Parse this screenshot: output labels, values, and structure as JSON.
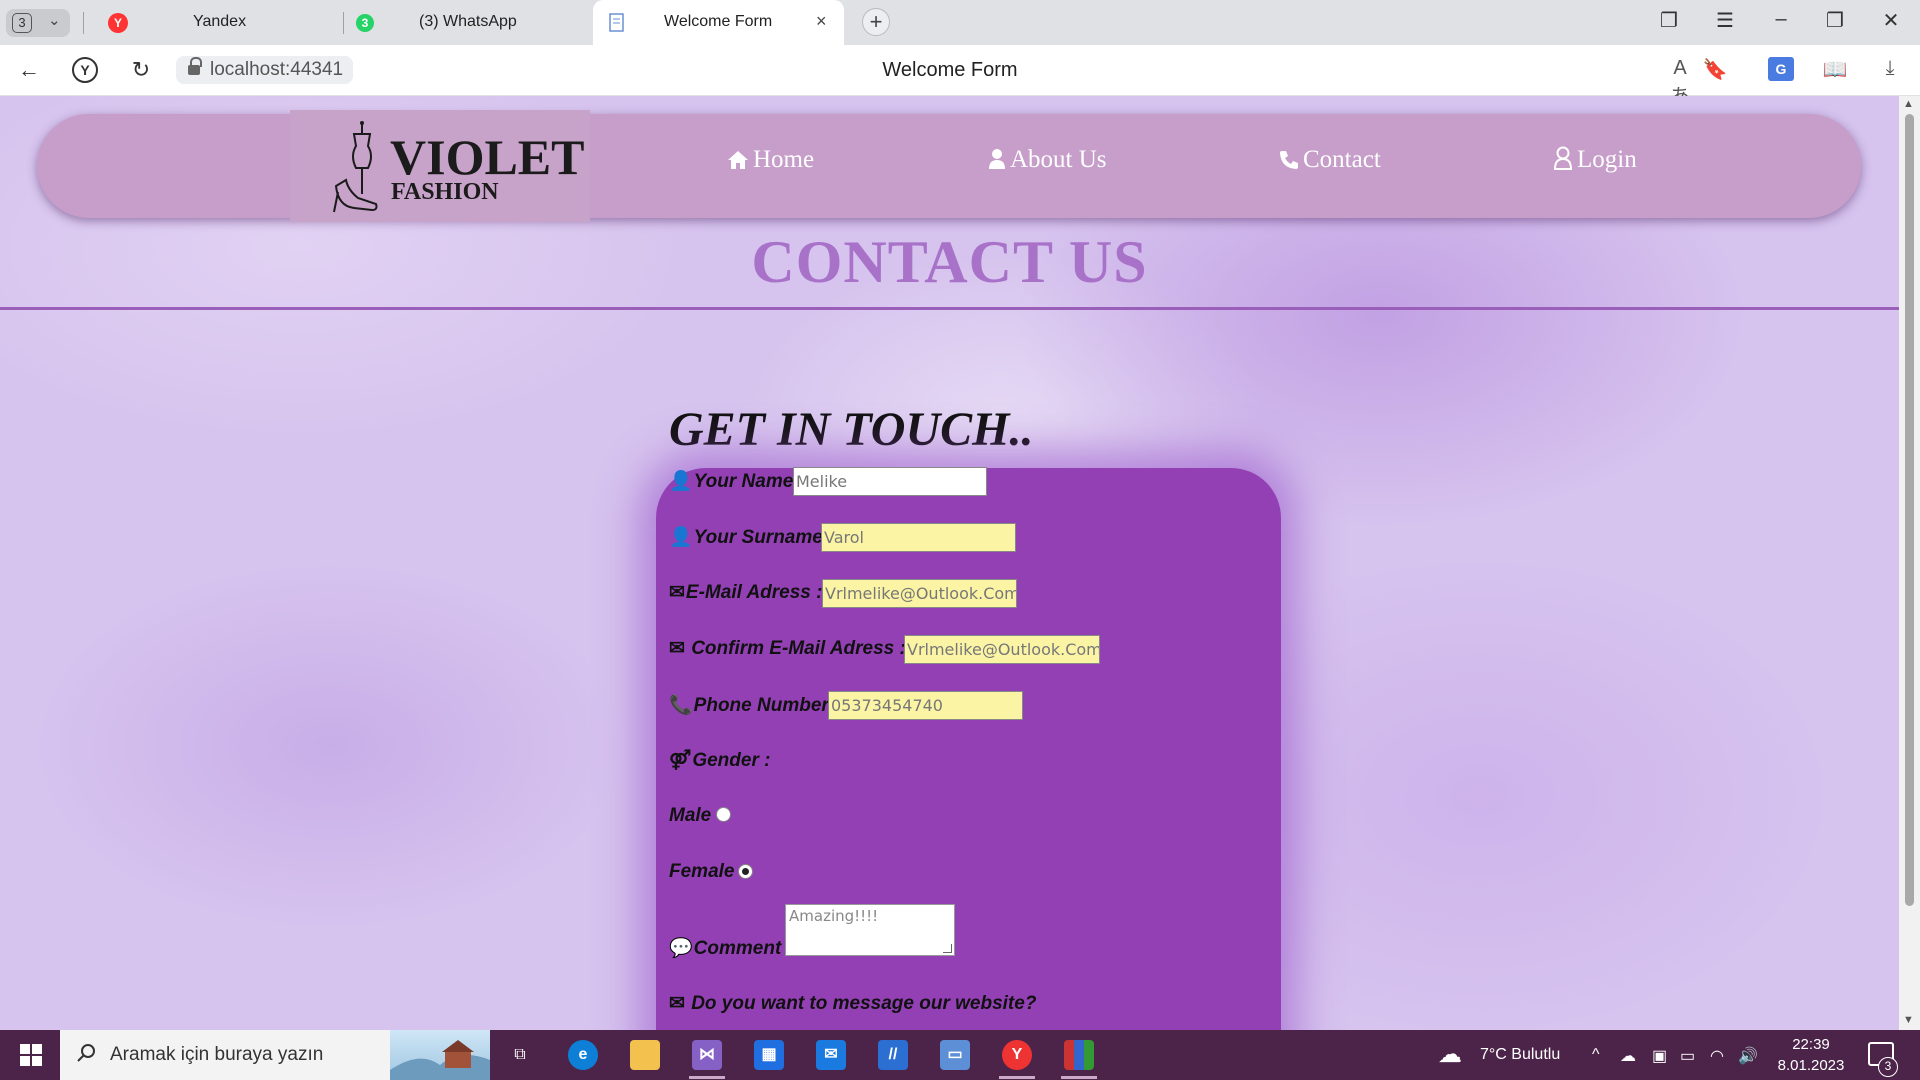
{
  "browser": {
    "tab_count": "3",
    "tabs": [
      {
        "title": "Yandex",
        "favicon": "Y",
        "color": "#f33"
      },
      {
        "title": "(3) WhatsApp",
        "favicon": "3",
        "color": "#25d366"
      },
      {
        "title": "Welcome Form",
        "favicon": "doc-icon",
        "color": "#3a6fd8"
      }
    ],
    "url": "localhost:44341",
    "page_title": "Welcome Form"
  },
  "site": {
    "logo": {
      "word1": "VIOLET",
      "word2": "FASHION"
    },
    "nav": [
      {
        "label": "Home",
        "icon": "home-icon"
      },
      {
        "label": "About Us",
        "icon": "user-icon"
      },
      {
        "label": "Contact",
        "icon": "phone-icon"
      },
      {
        "label": "Login",
        "icon": "user-outline-icon"
      }
    ],
    "heading": "CONTACT US",
    "subheading": "GET IN TOUCH..",
    "form": {
      "name_label": "Your Name :",
      "name_value": "Melike",
      "surname_label": "Your Surname :",
      "surname_value": "Varol",
      "email_label": "E-Mail Adress :",
      "email_value": "Vrlmelike@Outlook.Com",
      "confirm_email_label": " Confirm E-Mail Adress :",
      "confirm_email_value": "Vrlmelike@Outlook.Com",
      "phone_label": "Phone Number :",
      "phone_value": "05373454740",
      "gender_label": "Gender :",
      "male_label": "Male",
      "female_label": "Female",
      "gender_selected": "Female",
      "comment_label": "Comment :",
      "comment_value": "Amazing!!!!",
      "message_label": " Do you want to message our website?"
    },
    "colors": {
      "accent": "#9340b5",
      "heading": "#a872c9",
      "navbar": "#c69ec9",
      "autofill": "#fbf4a5"
    }
  },
  "taskbar": {
    "search_placeholder": "Aramak için buraya yazın",
    "weather": "7°C  Bulutlu",
    "time": "22:39",
    "date": "8.01.2023",
    "notifications": "3",
    "apps": [
      "task-view-icon",
      "edge-icon",
      "file-explorer-icon",
      "visual-studio-icon",
      "microsoft-store-icon",
      "mail-icon",
      "app-icon",
      "remote-desktop-icon",
      "yandex-icon",
      "winrar-icon"
    ]
  }
}
